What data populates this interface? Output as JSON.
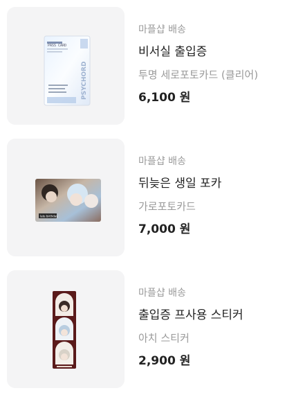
{
  "products": [
    {
      "shipping": "마플샵 배송",
      "title": "비서실 출입증",
      "option": "투명 세로포토카드 (클리어)",
      "price": "6,100 원",
      "card_text": {
        "heading": "PASS CARD",
        "side": "PSYCHORD"
      }
    },
    {
      "shipping": "마플샵 배송",
      "title": "뒤늦은 생일 포카",
      "option": "가로포토카드",
      "price": "7,000 원",
      "card_text": {
        "caption": "late birthday"
      }
    },
    {
      "shipping": "마플샵 배송",
      "title": "출입증 프사용 스티커",
      "option": "아치 스티커",
      "price": "2,900 원"
    }
  ],
  "colors": {
    "thumb_bg": "#f4f4f5",
    "muted_text": "#9a9a9a",
    "main_text": "#222222",
    "sticker_bg": "#5a1a1a"
  }
}
